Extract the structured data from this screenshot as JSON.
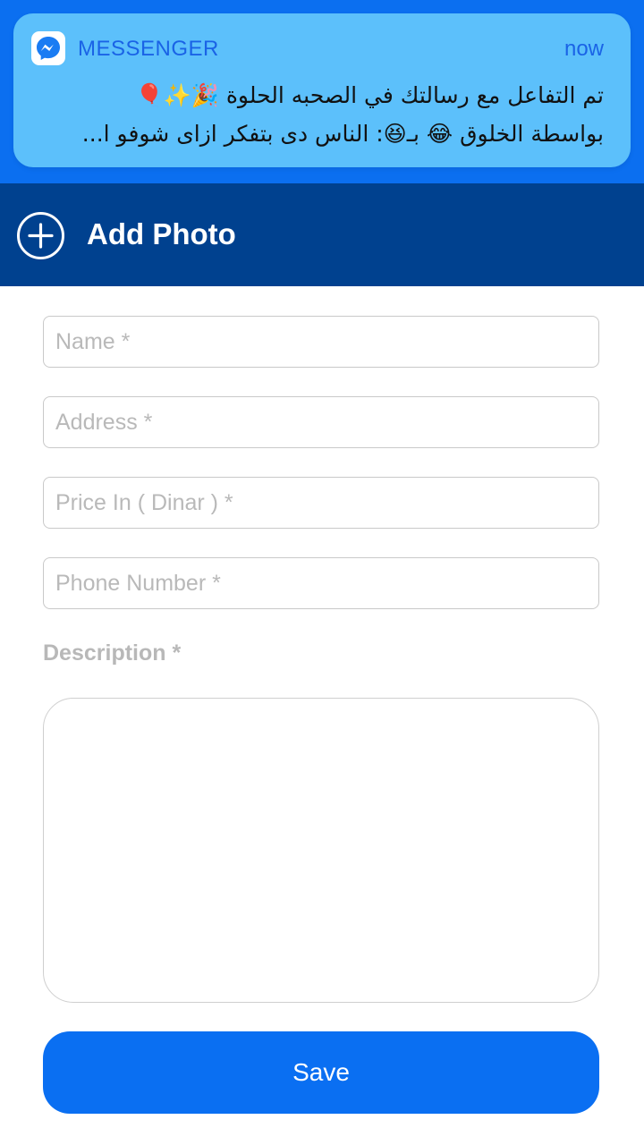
{
  "notification": {
    "app_icon": "messenger-icon",
    "app_name": "MESSENGER",
    "time": "now",
    "line1": "تم التفاعل مع رسالتك في الصحبه الحلوة 🎉✨🎈",
    "line2": "بواسطة الخلوق 😂 بـ😆: الناس دى بتفكر ازاى شوفو ا..."
  },
  "header": {
    "icon": "plus-circle-icon",
    "title": "Add Photo"
  },
  "form": {
    "name_placeholder": "Name *",
    "address_placeholder": "Address *",
    "price_placeholder": "Price In ( Dinar ) *",
    "phone_placeholder": "Phone Number *",
    "description_label": "Description *",
    "save_label": "Save"
  },
  "colors": {
    "top_band": "#0b6ff0",
    "notification_bg": "#5cc0fb",
    "header_bg": "#00418f",
    "save_button": "#0a6ff2"
  }
}
